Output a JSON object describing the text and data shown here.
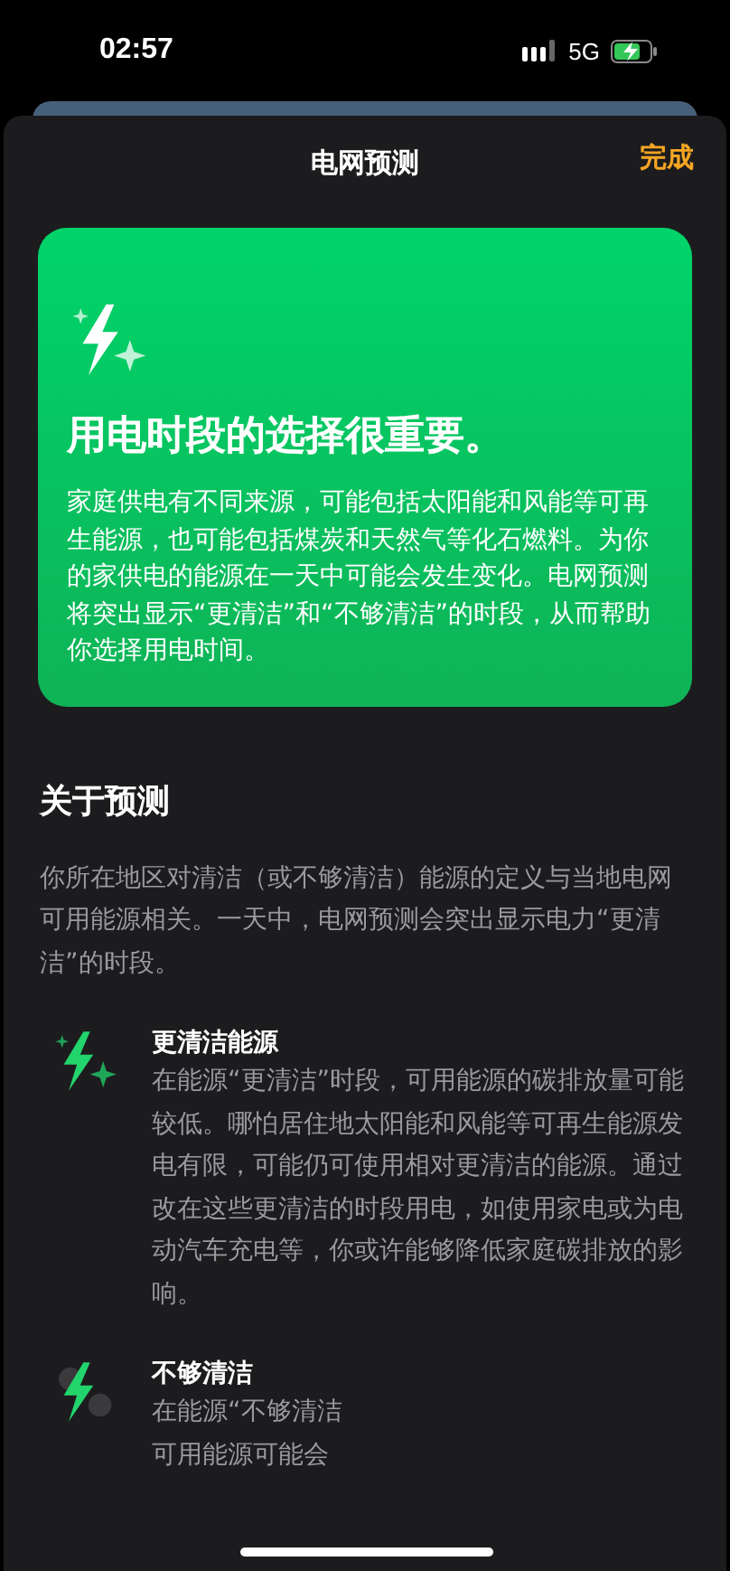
{
  "status_bar": {
    "time": "02:57",
    "network": "5G"
  },
  "sheet": {
    "title": "电网预测",
    "done": "完成"
  },
  "hero": {
    "headline": "用电时段的选择很重要。",
    "body": "家庭供电有不同来源，可能包括太阳能和风能等可再生能源，也可能包括煤炭和天然气等化石燃料。为你的家供电的能源在一天中可能会发生变化。电网预测将突出显示“更清洁”和“不够清洁”的时段，从而帮助你选择用电时间。"
  },
  "about": {
    "title": "关于预测",
    "body": "你所在地区对清洁（或不够清洁）能源的定义与当地电网可用能源相关。一天中，电网预测会突出显示电力“更清洁”的时段。"
  },
  "items": [
    {
      "kind": "cleaner",
      "title": "更清洁能源",
      "lines": [
        "在能源“更清洁”时段，可用能源的碳排放量可能较低。哪怕居住地太阳能和风能等可再生能源发电有限，可能仍可使用相对更清洁的能源。通过改在这些更清洁的时段用电，如使用家电或为电动汽车充电等，你或许能够降低家庭碳排放的影响。"
      ]
    },
    {
      "kind": "less_clean",
      "title": "不够清洁",
      "lines": [
        "在能源“不够清洁",
        "可用能源可能会"
      ]
    }
  ]
}
